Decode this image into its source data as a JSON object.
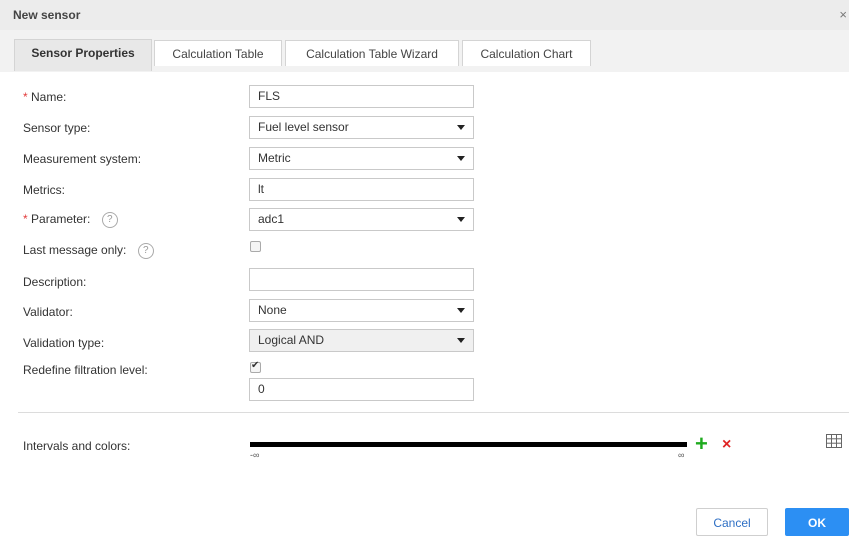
{
  "window": {
    "title": "New sensor",
    "close_symbol": "×"
  },
  "tabs": [
    {
      "label": "Sensor Properties",
      "active": true
    },
    {
      "label": "Calculation Table",
      "active": false
    },
    {
      "label": "Calculation Table Wizard",
      "active": false
    },
    {
      "label": "Calculation Chart",
      "active": false
    }
  ],
  "form": {
    "required_mark": "*",
    "help_symbol": "?",
    "name_label": "Name:",
    "name_value": "FLS",
    "sensor_type_label": "Sensor type:",
    "sensor_type_value": "Fuel level sensor",
    "measurement_label": "Measurement system:",
    "measurement_value": "Metric",
    "metrics_label": "Metrics:",
    "metrics_value": "lt",
    "parameter_label": "Parameter:",
    "parameter_value": "adc1",
    "last_message_label": "Last message only:",
    "last_message_checked": false,
    "description_label": "Description:",
    "description_value": "",
    "validator_label": "Validator:",
    "validator_value": "None",
    "validation_type_label": "Validation type:",
    "validation_type_value": "Logical AND",
    "redefine_label": "Redefine filtration level:",
    "redefine_checked": true,
    "filtration_value": "0"
  },
  "intervals": {
    "label": "Intervals and colors:",
    "min_label": "-∞",
    "max_label": "∞",
    "bar_color": "#000000",
    "add_symbol": "+",
    "delete_symbol": "×"
  },
  "buttons": {
    "cancel": "Cancel",
    "ok": "OK"
  },
  "colors": {
    "accent": "#2c8ff3",
    "add": "#1eaa1e",
    "delete": "#e02424",
    "required": "#e23b3b"
  }
}
